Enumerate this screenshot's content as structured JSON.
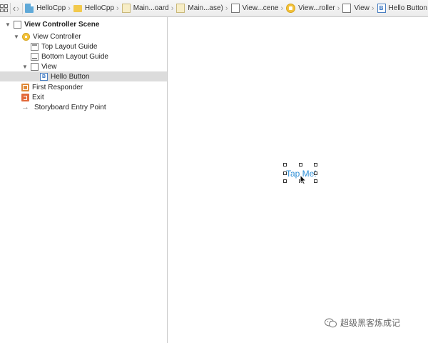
{
  "jumpbar": {
    "crumbs": [
      {
        "label": "HelloCpp",
        "icon": "swift-file-icon"
      },
      {
        "label": "HelloCpp",
        "icon": "folder-icon"
      },
      {
        "label": "Main...oard",
        "icon": "storyboard-file-icon"
      },
      {
        "label": "Main...ase)",
        "icon": "storyboard-file-icon"
      },
      {
        "label": "View...cene",
        "icon": "scene-icon"
      },
      {
        "label": "View...roller",
        "icon": "view-controller-icon"
      },
      {
        "label": "View",
        "icon": "view-icon"
      },
      {
        "label": "Hello Button",
        "icon": "button-icon"
      }
    ]
  },
  "outline": {
    "scene": "View Controller Scene",
    "view_controller": "View Controller",
    "top_layout_guide": "Top Layout Guide",
    "bottom_layout_guide": "Bottom Layout Guide",
    "view": "View",
    "hello_button": "Hello Button",
    "first_responder": "First Responder",
    "exit": "Exit",
    "entry_point": "Storyboard Entry Point"
  },
  "canvas": {
    "button_title": "Tap Me!"
  },
  "watermark": {
    "text": "超级黑客炼成记"
  },
  "colors": {
    "button_text": "#2f8fd6",
    "selection": "#dcdcdc",
    "view_controller_icon": "#f3c23b"
  }
}
